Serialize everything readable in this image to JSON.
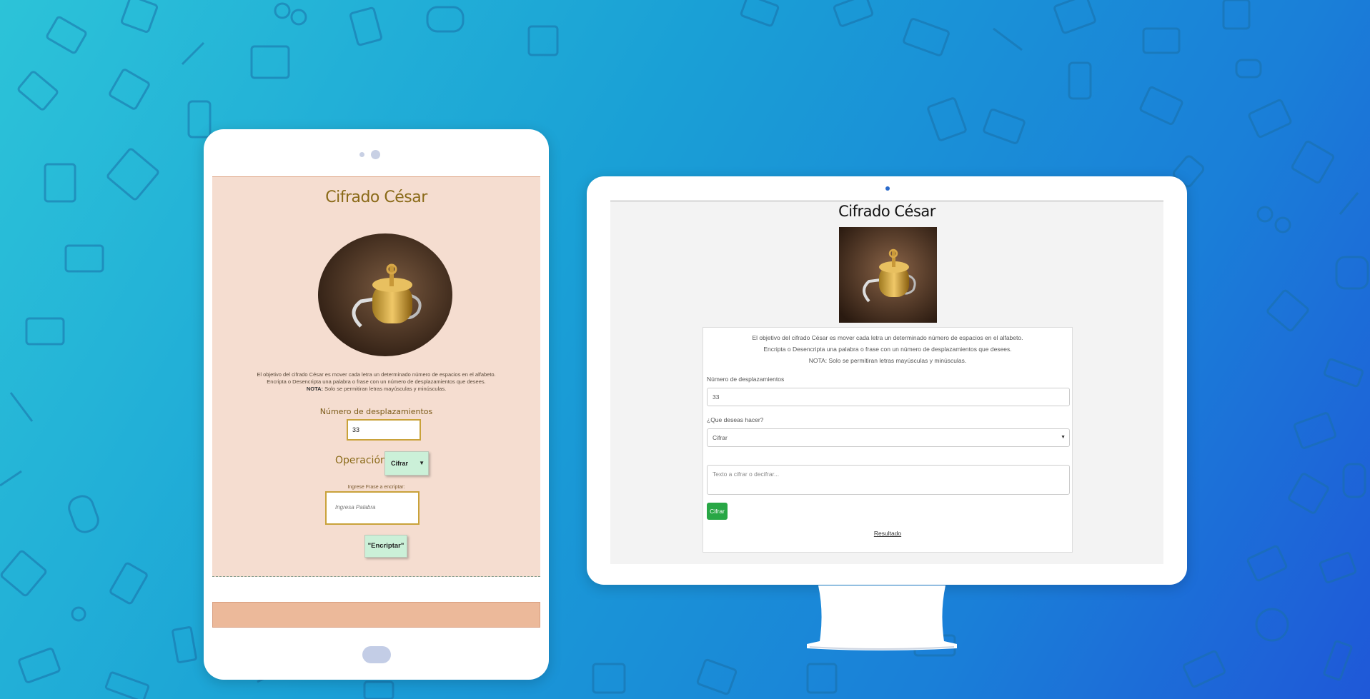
{
  "colors": {
    "accent_gold": "#8a6a18",
    "tablet_bg": "#f5ddd0",
    "button_green_pale": "#cbf0d8",
    "button_green": "#28a745"
  },
  "tablet": {
    "title": "Cifrado César",
    "desc_line1": "El objetivo del cifrado César es mover cada letra un determinado número de espacios en el alfabeto.",
    "desc_line2": "Encripta o Desencripta una palabra o frase con un número de desplazamientos que desees.",
    "desc_note_label": "NOTA:",
    "desc_note_text": " Solo se permitiran letras mayúsculas y minúsculas.",
    "shift_label": "Número de desplazamientos",
    "shift_value": "33",
    "operation_label": "Operación",
    "operation_value": "Cifrar",
    "phrase_label": "Ingrese Frase a encriptar:",
    "phrase_placeholder": "Ingresa Palabra",
    "encrypt_button": "\"Encriptar\""
  },
  "monitor": {
    "title": "Cifrado César",
    "desc_line1": "El objetivo del cifrado César es mover cada letra un determinado número de espacios en el alfabeto.",
    "desc_line2": "Encripta o Desencripta una palabra o frase con un número de desplazamientos que desees.",
    "desc_line3": "NOTA: Solo se permitiran letras mayúsculas y minúsculas.",
    "shift_label": "Número de desplazamientos",
    "shift_value": "33",
    "action_label": "¿Que deseas hacer?",
    "action_value": "Cifrar",
    "text_placeholder": "Texto a cifrar o decifrar...",
    "submit_button": "Cifrar",
    "result_link": "Resultado"
  },
  "icons": {
    "lock_image": "padlock-image",
    "dropdown": "chevron-down-icon"
  }
}
